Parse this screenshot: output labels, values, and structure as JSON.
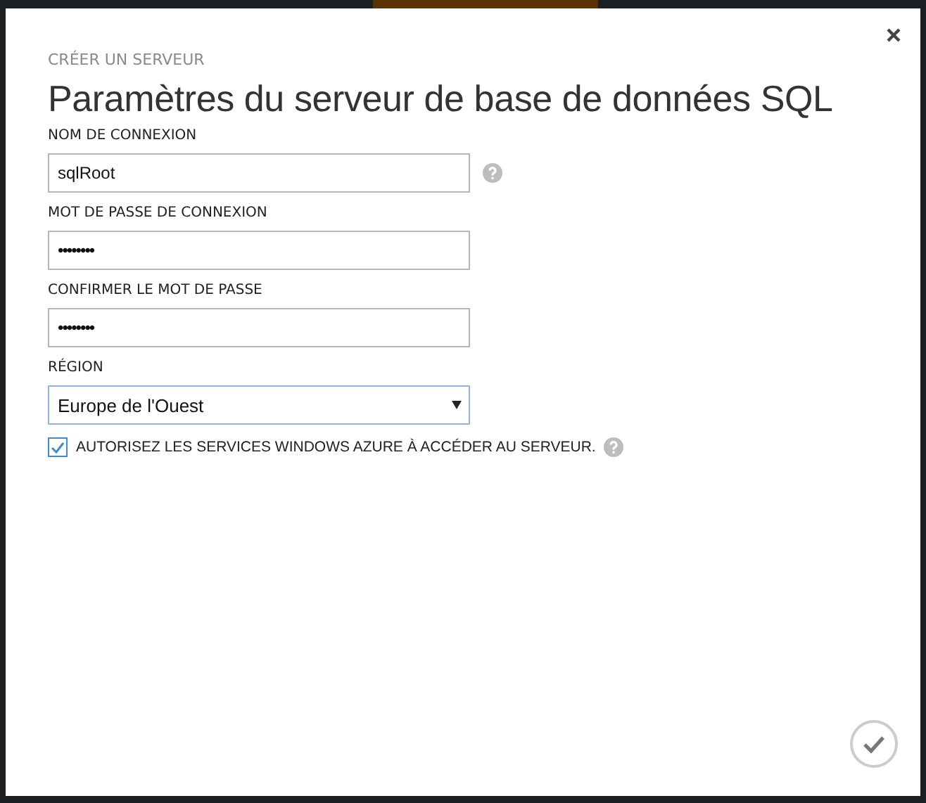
{
  "dialog": {
    "eyebrow": "CRÉER UN SERVEUR",
    "title": "Paramètres du serveur de base de données SQL"
  },
  "fields": [
    {
      "kind": "text",
      "label": "NOM DE CONNEXION",
      "value": "sqlRoot",
      "help": true
    },
    {
      "kind": "password",
      "label": "MOT DE PASSE DE CONNEXION",
      "value": "••••••••",
      "help": false
    },
    {
      "kind": "password",
      "label": "CONFIRMER LE MOT DE PASSE",
      "value": "••••••••",
      "help": false
    },
    {
      "kind": "select",
      "label": "RÉGION",
      "value": "Europe de l'Ouest",
      "help": false
    }
  ],
  "allow_azure": {
    "label": "AUTORISEZ LES SERVICES WINDOWS AZURE À ACCÉDER AU SERVEUR.",
    "checked": true,
    "help": true
  }
}
